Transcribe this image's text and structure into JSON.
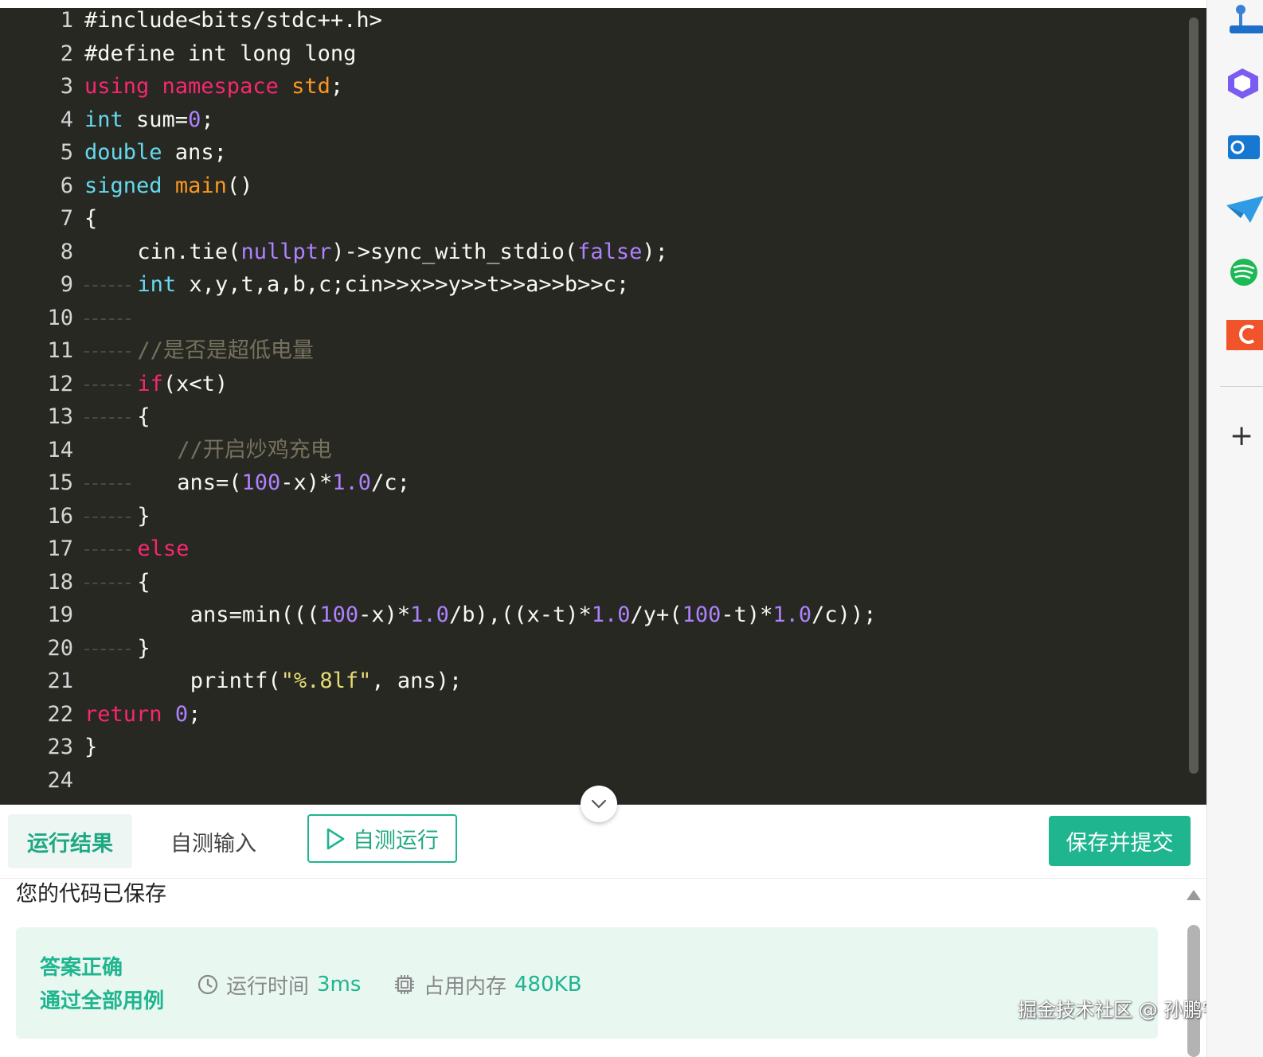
{
  "editor": {
    "lines": [
      {
        "n": "1",
        "indent": 0,
        "tokens": [
          {
            "c": "",
            "t": "#include<bits/stdc++.h>"
          }
        ]
      },
      {
        "n": "2",
        "indent": 0,
        "tokens": [
          {
            "c": "",
            "t": "#define int long long"
          }
        ]
      },
      {
        "n": "3",
        "indent": 0,
        "tokens": [
          {
            "c": "t-red",
            "t": "using namespace "
          },
          {
            "c": "t-fn",
            "t": "std"
          },
          {
            "c": "",
            "t": ";"
          }
        ]
      },
      {
        "n": "4",
        "indent": 0,
        "tokens": [
          {
            "c": "t-kw",
            "t": "int"
          },
          {
            "c": "",
            "t": " sum="
          },
          {
            "c": "t-num",
            "t": "0"
          },
          {
            "c": "",
            "t": ";"
          }
        ]
      },
      {
        "n": "5",
        "indent": 0,
        "tokens": [
          {
            "c": "t-kw",
            "t": "double"
          },
          {
            "c": "",
            "t": " ans;"
          }
        ]
      },
      {
        "n": "6",
        "indent": 0,
        "tokens": [
          {
            "c": "t-kw",
            "t": "signed"
          },
          {
            "c": "",
            "t": " "
          },
          {
            "c": "t-fn",
            "t": "main"
          },
          {
            "c": "",
            "t": "()"
          }
        ]
      },
      {
        "n": "7",
        "indent": 0,
        "tokens": [
          {
            "c": "",
            "t": "{"
          }
        ]
      },
      {
        "n": "8",
        "indent": 4,
        "tokens": [
          {
            "c": "",
            "t": "cin.tie("
          },
          {
            "c": "t-num",
            "t": "nullptr"
          },
          {
            "c": "",
            "t": ")->sync_with_stdio("
          },
          {
            "c": "t-num",
            "t": "false"
          },
          {
            "c": "",
            "t": ");"
          }
        ]
      },
      {
        "n": "9",
        "indent": 4,
        "guide": true,
        "tokens": [
          {
            "c": "t-kw",
            "t": "int"
          },
          {
            "c": "",
            "t": " x,y,t,a,b,c;cin>>x>>y>>t>>a>>b>>c;"
          }
        ]
      },
      {
        "n": "10",
        "indent": 4,
        "guide": true,
        "tokens": []
      },
      {
        "n": "11",
        "indent": 4,
        "guide": true,
        "tokens": [
          {
            "c": "t-cm",
            "t": "//是否是超低电量"
          }
        ]
      },
      {
        "n": "12",
        "indent": 4,
        "guide": true,
        "tokens": [
          {
            "c": "t-red",
            "t": "if"
          },
          {
            "c": "",
            "t": "(x<t)"
          }
        ]
      },
      {
        "n": "13",
        "indent": 4,
        "guide": true,
        "tokens": [
          {
            "c": "",
            "t": "{"
          }
        ]
      },
      {
        "n": "14",
        "indent": 7,
        "tokens": [
          {
            "c": "t-cm",
            "t": "//开启炒鸡充电"
          }
        ]
      },
      {
        "n": "15",
        "indent": 7,
        "guide": true,
        "tokens": [
          {
            "c": "",
            "t": "ans=("
          },
          {
            "c": "t-num",
            "t": "100"
          },
          {
            "c": "",
            "t": "-x)*"
          },
          {
            "c": "t-num",
            "t": "1.0"
          },
          {
            "c": "",
            "t": "/c;"
          }
        ]
      },
      {
        "n": "16",
        "indent": 4,
        "guide": true,
        "tokens": [
          {
            "c": "",
            "t": "}"
          }
        ]
      },
      {
        "n": "17",
        "indent": 4,
        "guide": true,
        "tokens": [
          {
            "c": "t-red",
            "t": "else"
          }
        ]
      },
      {
        "n": "18",
        "indent": 4,
        "guide": true,
        "tokens": [
          {
            "c": "",
            "t": "{"
          }
        ]
      },
      {
        "n": "19",
        "indent": 8,
        "tokens": [
          {
            "c": "",
            "t": "ans=min((("
          },
          {
            "c": "t-num",
            "t": "100"
          },
          {
            "c": "",
            "t": "-x)*"
          },
          {
            "c": "t-num",
            "t": "1.0"
          },
          {
            "c": "",
            "t": "/b),((x-t)*"
          },
          {
            "c": "t-num",
            "t": "1.0"
          },
          {
            "c": "",
            "t": "/y+("
          },
          {
            "c": "t-num",
            "t": "100"
          },
          {
            "c": "",
            "t": "-t)*"
          },
          {
            "c": "t-num",
            "t": "1.0"
          },
          {
            "c": "",
            "t": "/c));"
          }
        ]
      },
      {
        "n": "20",
        "indent": 4,
        "guide": true,
        "tokens": [
          {
            "c": "",
            "t": "}"
          }
        ]
      },
      {
        "n": "21",
        "indent": 8,
        "tokens": [
          {
            "c": "",
            "t": "printf("
          },
          {
            "c": "t-str",
            "t": "\"%.8lf\""
          },
          {
            "c": "",
            "t": ", ans);"
          }
        ]
      },
      {
        "n": "22",
        "indent": 0,
        "tokens": [
          {
            "c": "t-red",
            "t": "return"
          },
          {
            "c": "",
            "t": " "
          },
          {
            "c": "t-num",
            "t": "0"
          },
          {
            "c": "",
            "t": ";"
          }
        ]
      },
      {
        "n": "23",
        "indent": 0,
        "tokens": [
          {
            "c": "",
            "t": "}"
          }
        ]
      },
      {
        "n": "24",
        "indent": 0,
        "tokens": []
      }
    ]
  },
  "toolbar": {
    "tab_result": "运行结果",
    "tab_input": "自测输入",
    "run_label": "自测运行",
    "submit_label": "保存并提交"
  },
  "result": {
    "saved_message": "您的代码已保存",
    "verdict_line1": "答案正确",
    "verdict_line2": "通过全部用例",
    "time_label": "运行时间",
    "time_value": "3ms",
    "memory_label": "占用内存",
    "memory_value": "480KB"
  },
  "watermark": "掘金技术社区 @ 孙鹏宇",
  "colors": {
    "accent": "#1fb58f",
    "editor_bg": "#272822"
  },
  "rail": {
    "icons": [
      "joystick-icon",
      "copilot-icon",
      "outlook-icon",
      "telegram-icon",
      "spotify-icon",
      "orange-app-icon",
      "add-icon"
    ]
  }
}
